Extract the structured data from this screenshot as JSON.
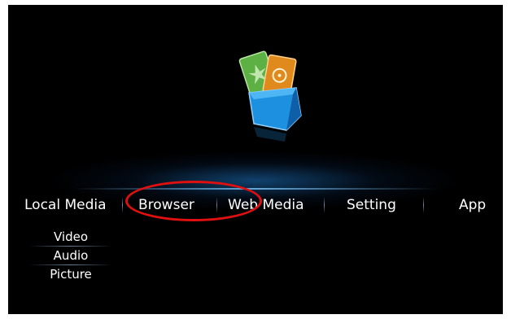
{
  "menu": {
    "items": [
      {
        "label": "Local Media"
      },
      {
        "label": "Browser"
      },
      {
        "label": "Web Media"
      },
      {
        "label": "Setting"
      },
      {
        "label": "App"
      }
    ]
  },
  "submenu": {
    "items": [
      {
        "label": "Video"
      },
      {
        "label": "Audio"
      },
      {
        "label": "Picture"
      }
    ]
  },
  "colors": {
    "background": "#000000",
    "highlight_ring": "#e01010",
    "glow": "#1e78c8"
  },
  "icons": {
    "center": "media-box-icon"
  }
}
